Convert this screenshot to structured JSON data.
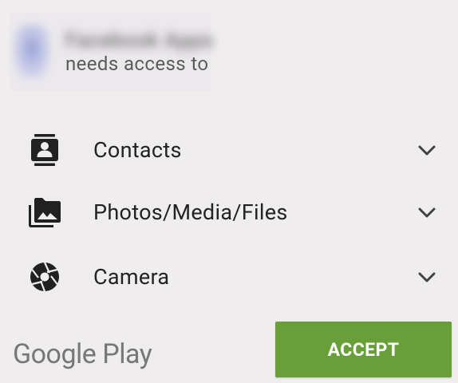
{
  "header": {
    "app_name": "Facebook Apps",
    "subtitle": "needs access to"
  },
  "permissions": [
    {
      "label": "Contacts",
      "icon": "contacts-icon"
    },
    {
      "label": "Photos/Media/Files",
      "icon": "photos-folder-icon"
    },
    {
      "label": "Camera",
      "icon": "camera-aperture-icon"
    }
  ],
  "footer": {
    "brand": "Google Play",
    "accept_label": "ACCEPT"
  },
  "colors": {
    "background": "#efedee",
    "accept_button": "#689f38",
    "icon": "#212121",
    "brand_text": "#777777"
  }
}
